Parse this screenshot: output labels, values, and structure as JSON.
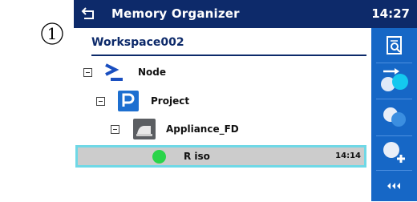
{
  "step_marker": {
    "number": "1"
  },
  "titlebar": {
    "title": "Memory Organizer",
    "clock": "14:27"
  },
  "tree": {
    "workspace": "Workspace002",
    "nodes": [
      {
        "label": "Node",
        "icon": "node-prompt-icon"
      },
      {
        "label": "Project",
        "icon": "project-icon"
      },
      {
        "label": "Appliance_FD",
        "icon": "appliance-icon"
      }
    ],
    "selected_item": {
      "label": "R iso",
      "time": "14:14",
      "status_color": "#2ad44a"
    }
  },
  "sidebar": {
    "buttons": [
      {
        "icon": "search-document-icon"
      },
      {
        "icon": "start-test-icon"
      },
      {
        "icon": "clone-icon"
      },
      {
        "icon": "add-structure-icon"
      },
      {
        "icon": "more-options-icon"
      }
    ]
  },
  "colors": {
    "titlebar": "#0d2a6a",
    "sidebar": "#1667c6",
    "selection_border": "#6fd8e6",
    "selection_fill": "#cccccc"
  }
}
